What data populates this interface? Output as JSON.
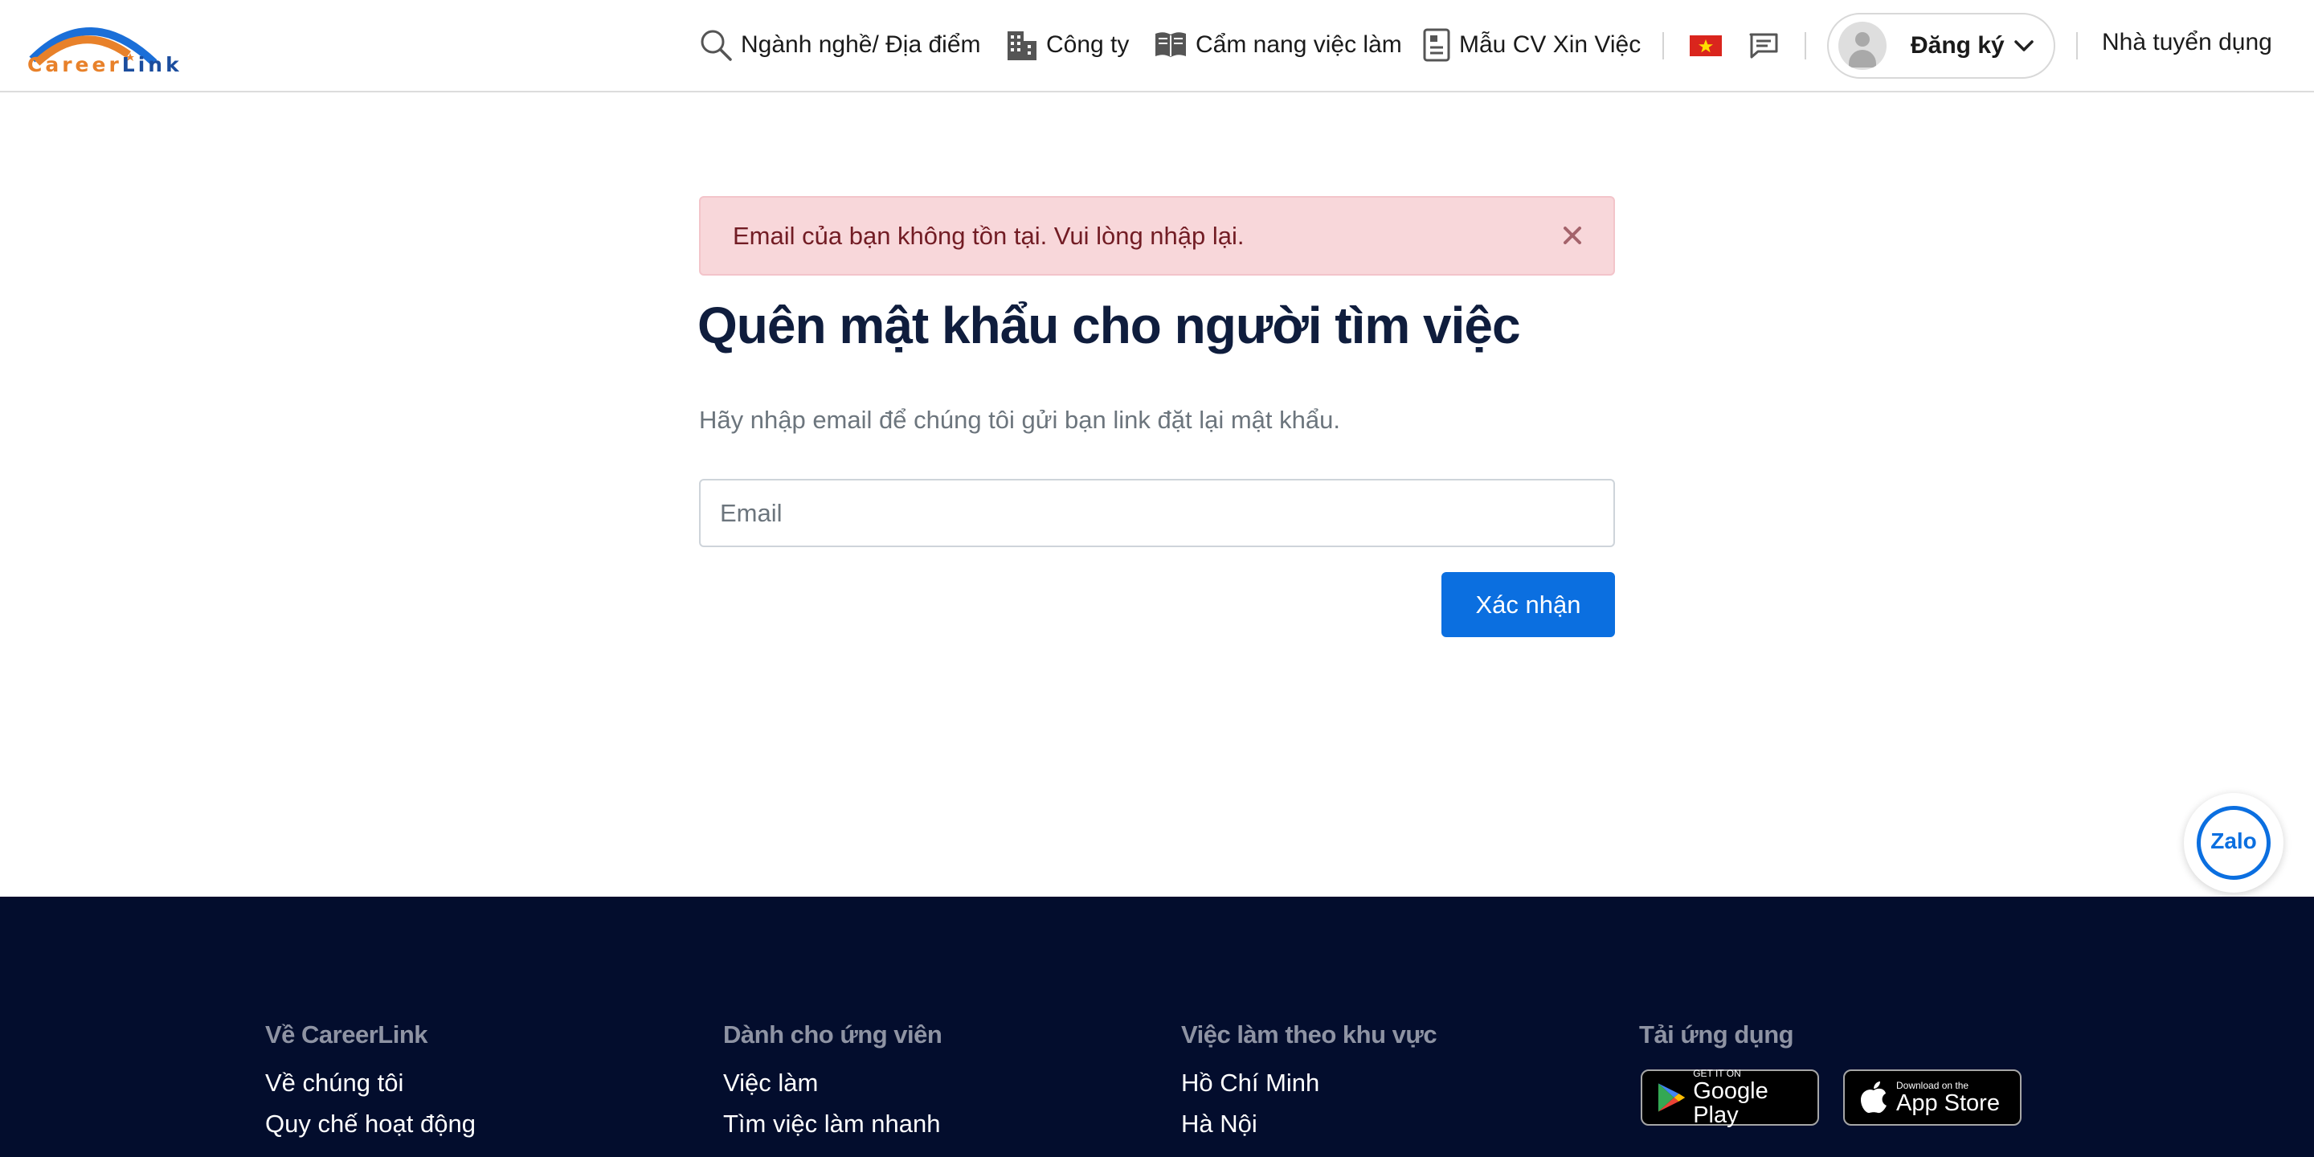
{
  "header": {
    "logo": {
      "part1": "Career",
      "part2": "Link"
    },
    "nav": [
      {
        "label": "Ngành nghề/ Địa điểm",
        "icon": "search-icon"
      },
      {
        "label": "Công ty",
        "icon": "building-icon"
      },
      {
        "label": "Cẩm nang việc làm",
        "icon": "book-icon"
      },
      {
        "label": "Mẫu CV Xin Việc",
        "icon": "document-icon"
      }
    ],
    "account_label": "Đăng ký",
    "employer_link": "Nhà tuyển dụng"
  },
  "alert": {
    "message": "Email của bạn không tồn tại. Vui lòng nhập lại."
  },
  "form": {
    "title": "Quên mật khẩu cho người tìm việc",
    "subtitle": "Hãy nhập email để chúng tôi gửi bạn link đặt lại mật khẩu.",
    "email_placeholder": "Email",
    "email_value": "",
    "submit_label": "Xác nhận"
  },
  "zalo": {
    "label": "Zalo"
  },
  "footer": {
    "columns": [
      {
        "heading": "Về CareerLink",
        "links": [
          "Về chúng tôi",
          "Quy chế hoạt động"
        ]
      },
      {
        "heading": "Dành cho ứng viên",
        "links": [
          "Việc làm",
          "Tìm việc làm nhanh"
        ]
      },
      {
        "heading": "Việc làm theo khu vực",
        "links": [
          "Hồ Chí Minh",
          "Hà Nội"
        ]
      },
      {
        "heading": "Tải ứng dụng",
        "links": []
      }
    ],
    "stores": [
      {
        "small": "GET IT ON",
        "big": "Google Play"
      },
      {
        "small": "Download on the",
        "big": "App Store"
      }
    ]
  },
  "colors": {
    "primary": "#0b6fe0",
    "footer_bg": "#030d2d",
    "alert_bg": "#f8d7da",
    "alert_text": "#721c24",
    "logo_orange": "#e8812a",
    "logo_blue": "#1b4d9e"
  }
}
